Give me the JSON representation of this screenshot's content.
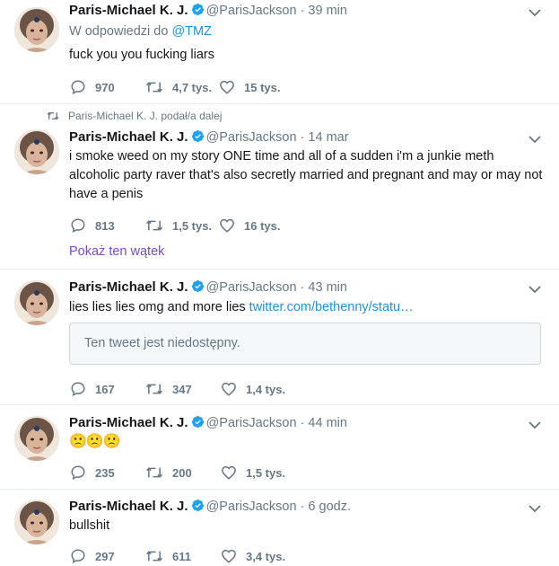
{
  "tweets": [
    {
      "name": "Paris-Michael K. J.",
      "handle": "@ParisJackson",
      "dot": "·",
      "time": "39 min",
      "reply_prefix": "W odpowiedzi do ",
      "reply_to": "@TMZ",
      "text": "fuck you you fucking liars",
      "replies": "970",
      "retweets": "4,7 tys.",
      "likes": "15 tys."
    },
    {
      "retweet_context": "Paris-Michael K. J. podał/a dalej",
      "name": "Paris-Michael K. J.",
      "handle": "@ParisJackson",
      "dot": "·",
      "time": "14 mar",
      "text": "i smoke weed on my story ONE time and all of a sudden i'm a junkie meth alcoholic party raver that's also secretly married and pregnant and may or may not have a penis",
      "replies": "813",
      "retweets": "1,5 tys.",
      "likes": "16 tys.",
      "thread_link": "Pokaż ten wątek"
    },
    {
      "name": "Paris-Michael K. J.",
      "handle": "@ParisJackson",
      "dot": "·",
      "time": "43 min",
      "text": "lies lies lies omg and more lies ",
      "link": "twitter.com/bethenny/statu…",
      "quoted_unavailable": "Ten tweet jest niedostępny.",
      "replies": "167",
      "retweets": "347",
      "likes": "1,4 tys."
    },
    {
      "name": "Paris-Michael K. J.",
      "handle": "@ParisJackson",
      "dot": "·",
      "time": "44 min",
      "emoji": "🙁🙁🙁",
      "replies": "235",
      "retweets": "200",
      "likes": "1,5 tys."
    },
    {
      "name": "Paris-Michael K. J.",
      "handle": "@ParisJackson",
      "dot": "·",
      "time": "6 godz.",
      "text": "bullshit",
      "replies": "297",
      "retweets": "611",
      "likes": "3,4 tys."
    }
  ],
  "icons": {
    "reply": "reply-icon",
    "retweet": "retweet-icon",
    "like": "like-icon",
    "verified": "verified-badge-icon",
    "caret": "chevron-down-icon"
  },
  "colors": {
    "text": "#14171a",
    "muted": "#657786",
    "link": "#1b95e0",
    "verified": "#1da1f2",
    "thread_link": "#794bc4",
    "border": "#e6ecf0"
  }
}
